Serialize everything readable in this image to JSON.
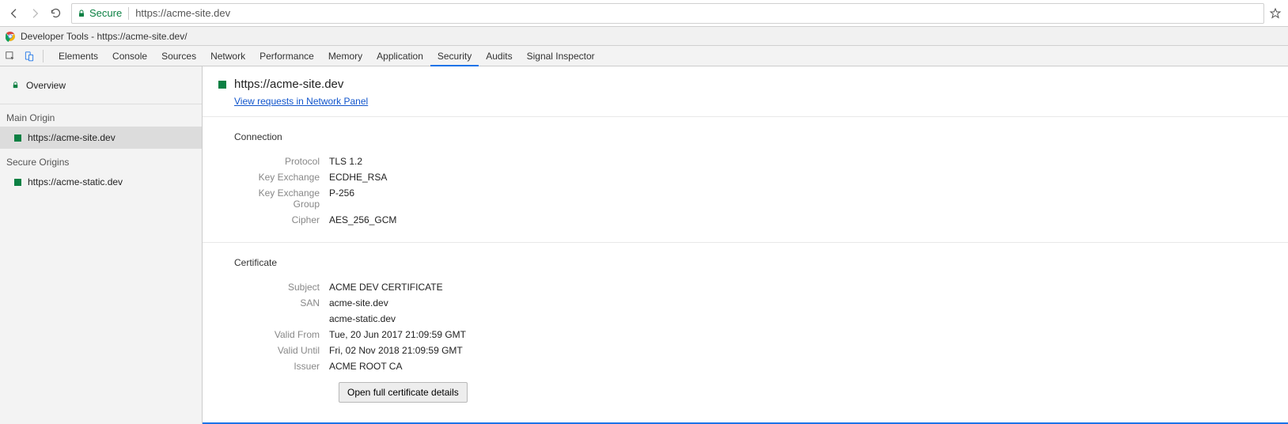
{
  "browser": {
    "secure_label": "Secure",
    "url": "https://acme-site.dev"
  },
  "devtools": {
    "title": "Developer Tools - https://acme-site.dev/",
    "tabs": [
      "Elements",
      "Console",
      "Sources",
      "Network",
      "Performance",
      "Memory",
      "Application",
      "Security",
      "Audits",
      "Signal Inspector"
    ],
    "active_tab": "Security"
  },
  "sidebar": {
    "overview_label": "Overview",
    "heading_main": "Main Origin",
    "heading_secure": "Secure Origins",
    "main_origin": "https://acme-site.dev",
    "secure_origin": "https://acme-static.dev"
  },
  "content": {
    "origin_title": "https://acme-site.dev",
    "network_link": "View requests in Network Panel",
    "connection": {
      "title": "Connection",
      "rows": {
        "protocol_k": "Protocol",
        "protocol_v": "TLS 1.2",
        "kex_k": "Key Exchange",
        "kex_v": "ECDHE_RSA",
        "kexg_k": "Key Exchange Group",
        "kexg_v": "P-256",
        "cipher_k": "Cipher",
        "cipher_v": "AES_256_GCM"
      }
    },
    "certificate": {
      "title": "Certificate",
      "rows": {
        "subject_k": "Subject",
        "subject_v": "ACME DEV CERTIFICATE",
        "san_k": "SAN",
        "san_v1": "acme-site.dev",
        "san_v2": "acme-static.dev",
        "vfrom_k": "Valid From",
        "vfrom_v": "Tue, 20 Jun 2017 21:09:59 GMT",
        "vuntil_k": "Valid Until",
        "vuntil_v": "Fri, 02 Nov 2018 21:09:59 GMT",
        "issuer_k": "Issuer",
        "issuer_v": "ACME ROOT CA"
      },
      "button": "Open full certificate details"
    }
  }
}
